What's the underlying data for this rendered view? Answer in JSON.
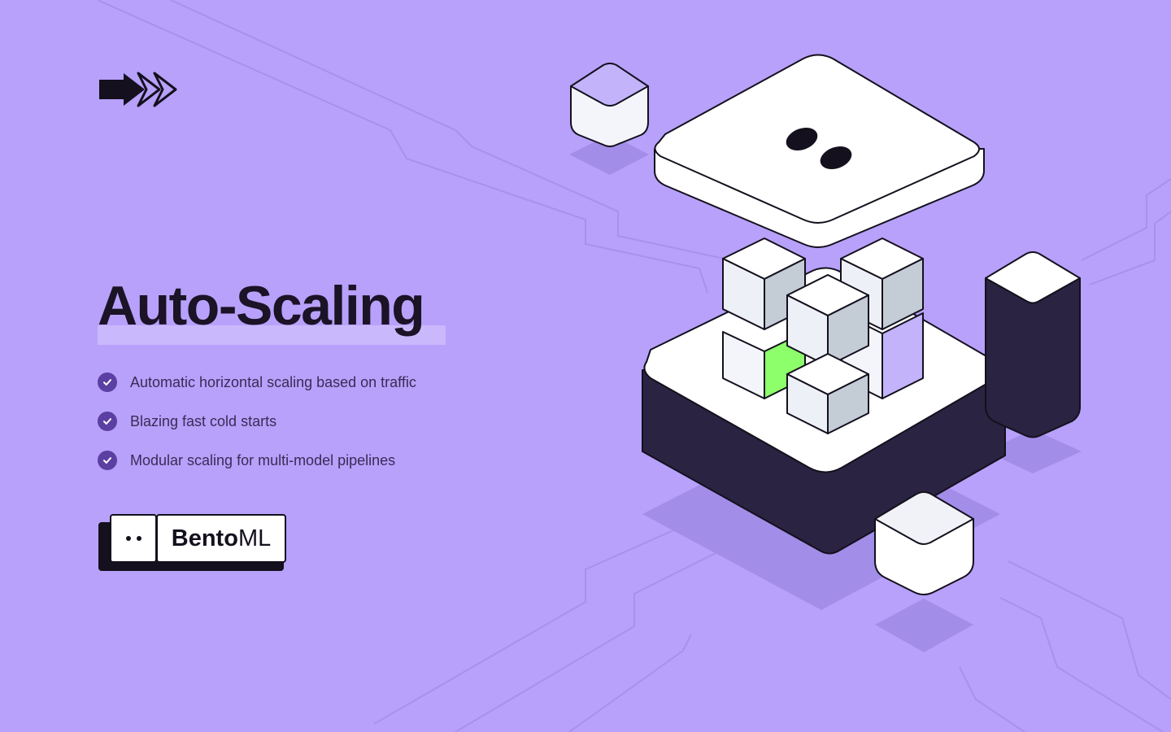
{
  "hero": {
    "title": "Auto-Scaling",
    "highlight_color": "#c9b9fc"
  },
  "features": [
    "Automatic horizontal scaling based on traffic",
    "Blazing fast cold starts",
    "Modular scaling for multi-model pipelines"
  ],
  "brand": {
    "name_bold": "Bento",
    "name_light": "ML"
  },
  "logo": {
    "icon": "double-arrow-icon"
  },
  "colors": {
    "background": "#b7a1fb",
    "ink": "#1b1326",
    "check_badge": "#5b3fa2",
    "base_dark": "#2a2341",
    "accent_green": "#8cff6a",
    "lavender": "#c2b3fa"
  }
}
